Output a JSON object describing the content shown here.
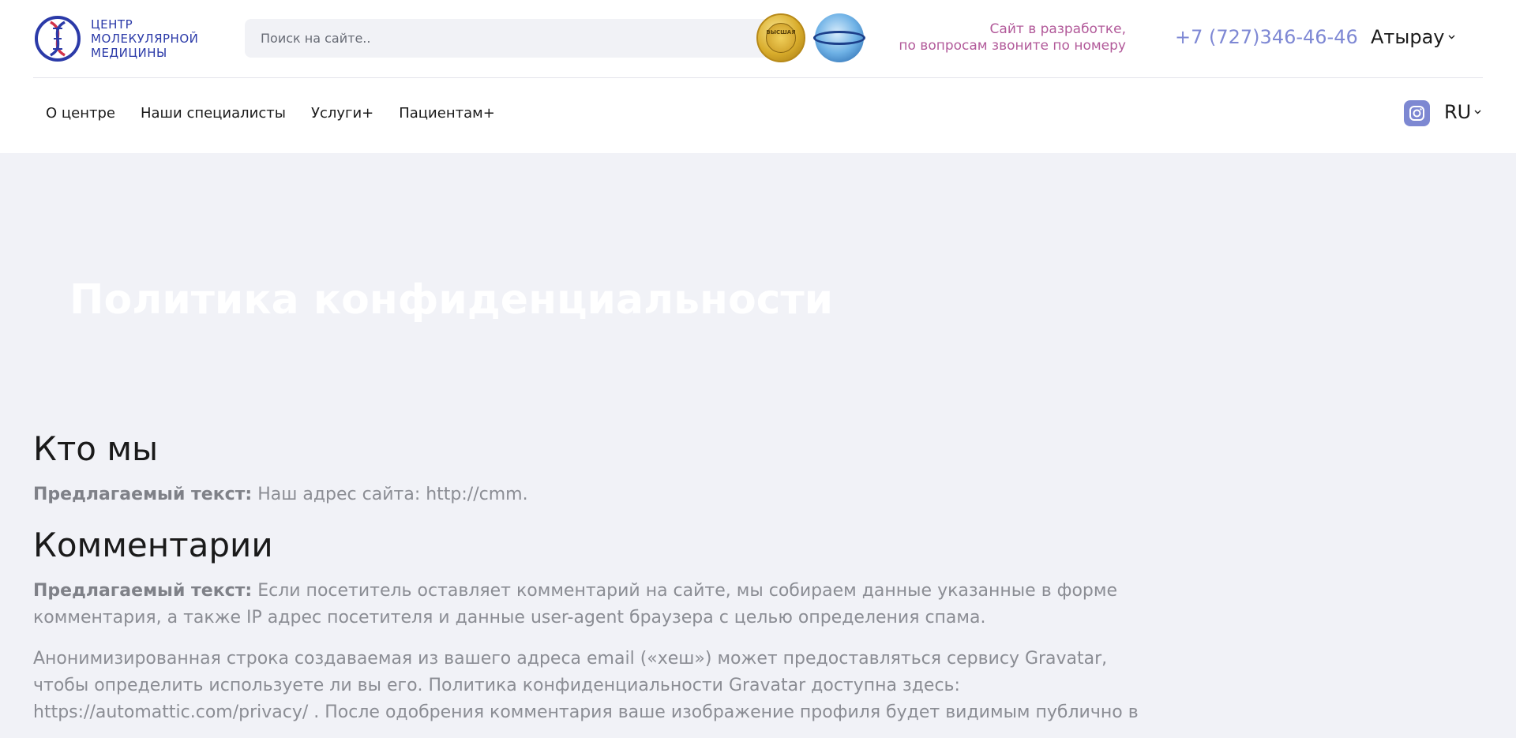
{
  "logo": {
    "line1": "ЦЕНТР",
    "line2": "МОЛЕКУЛЯРНОЙ",
    "line3": "МЕДИЦИНЫ"
  },
  "search": {
    "placeholder": "Поиск на сайте.."
  },
  "badges": {
    "gold_text": "ВЫСШАЯ"
  },
  "header": {
    "dev_line1": "Сайт в разработке,",
    "dev_line2": "по вопросам звоните по номеру",
    "phone": "+7 (727)346-46-46",
    "city": "Атырау"
  },
  "nav": {
    "items": [
      "О центре",
      "Наши специалисты",
      "Услуги+",
      "Пациентам+"
    ],
    "lang": "RU"
  },
  "hero": {
    "title": "Политика конфиденциальности"
  },
  "content": {
    "s1_title": "Кто мы",
    "s1_p1_label": "Предлагаемый текст:",
    "s1_p1_text": " Наш адрес сайта: http://cmm.",
    "s2_title": "Комментарии",
    "s2_p1_label": "Предлагаемый текст:",
    "s2_p1_text": " Если посетитель оставляет комментарий на сайте, мы собираем данные указанные в форме комментария, а также IP адрес посетителя и данные user-agent браузера с целью определения спама.",
    "s2_p2_text": "Анонимизированная строка создаваемая из вашего адреса email («хеш») может предоставляться сервису Gravatar, чтобы определить используете ли вы его. Политика конфиденциальности Gravatar доступна здесь: https://automattic.com/privacy/ . После одобрения комментария ваше изображение профиля будет видимым публично в"
  },
  "colors": {
    "brand_blue": "#2b3aa8",
    "accent_pink": "#b25a9a",
    "phone_blue": "#7e88d4",
    "page_bg": "#f1f2f7"
  }
}
